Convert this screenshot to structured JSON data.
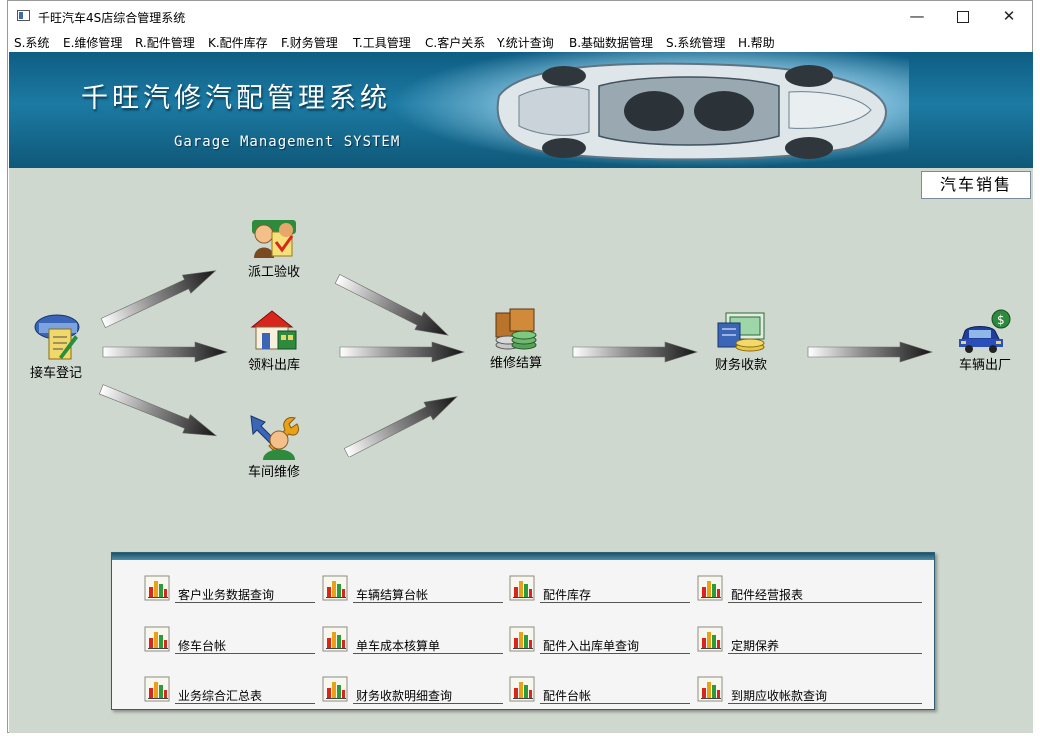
{
  "window": {
    "title": "千旺汽车4S店综合管理系统",
    "minimize_glyph": "—",
    "close_glyph": "✕"
  },
  "menu": [
    "S.系统",
    "E.维修管理",
    "R.配件管理",
    "K.配件库存",
    "F.财务管理",
    "T.工具管理",
    "C.客户关系",
    "Y.统计查询",
    "B.基础数据管理",
    "S.系统管理",
    "H.帮助"
  ],
  "banner": {
    "title": "千旺汽修汽配管理系统",
    "subtitle": "Garage Management SYSTEM"
  },
  "sales_button": "汽车销售",
  "flow": {
    "reception": "接车登记",
    "dispatch": "派工验收",
    "parts_issue": "领料出库",
    "workshop": "车间维修",
    "settlement": "维修结算",
    "payment": "财务收款",
    "exit": "车辆出厂"
  },
  "reports": [
    [
      "客户业务数据查询",
      "车辆结算台帐",
      "配件库存",
      "配件经营报表"
    ],
    [
      "修车台帐",
      "单车成本核算单",
      "配件入出库单查询",
      "定期保养"
    ],
    [
      "业务综合汇总表",
      "财务收款明细查询",
      "配件台帐",
      "到期应收帐款查询"
    ]
  ],
  "colors": {
    "banner": "#1c7aa3",
    "workspace": "#cfd8cf",
    "panel_border": "#2f5f75"
  },
  "icons": {
    "report": "bar-chart-icon",
    "reception": "clipboard-car-icon",
    "dispatch": "workers-icon",
    "parts_issue": "warehouse-icon",
    "workshop": "mechanic-icon",
    "settlement": "coins-icon",
    "payment": "cash-icon",
    "exit": "car-exit-icon"
  }
}
